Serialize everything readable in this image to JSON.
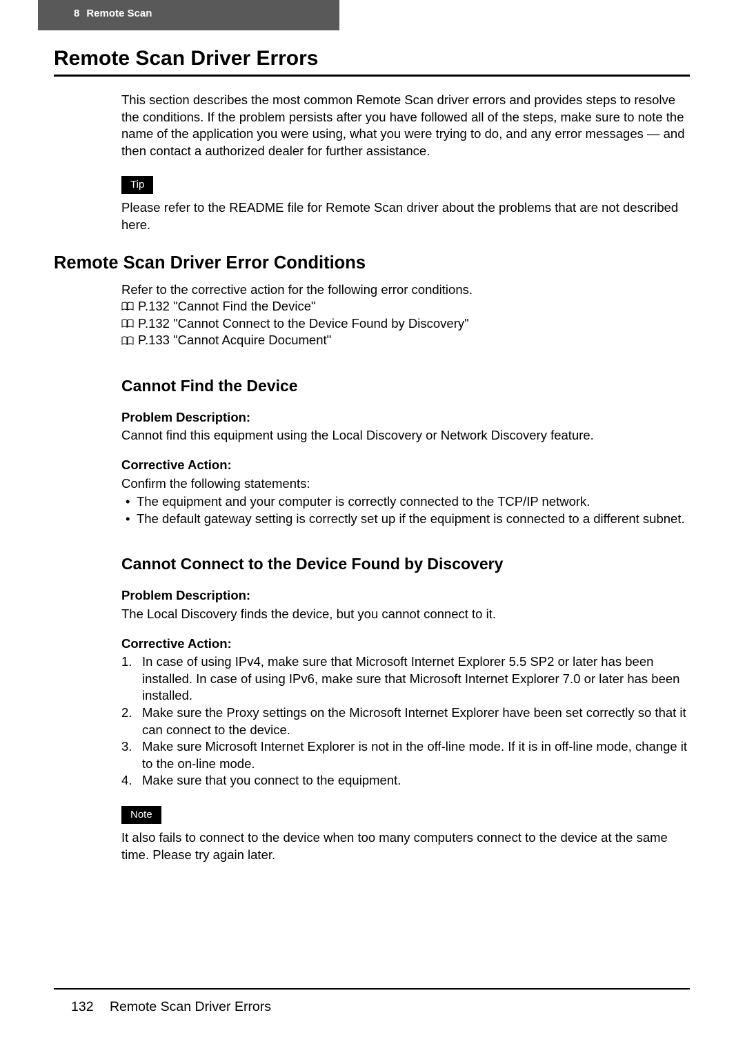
{
  "header": {
    "chapter_number": "8",
    "chapter_title": "Remote Scan"
  },
  "title": "Remote Scan Driver Errors",
  "intro": "This section describes the most common Remote Scan driver errors and provides steps to resolve the conditions. If the problem persists after you have followed all of the steps, make sure to note the name of the application you were using, what you were trying to do, and any error messages — and then contact a authorized dealer for further assistance.",
  "tip_label": "Tip",
  "tip_text": "Please refer to the README file for Remote Scan driver about the problems that are not described here.",
  "section2_title": "Remote Scan Driver Error Conditions",
  "refs": {
    "intro": "Refer to the corrective action for the following error conditions.",
    "items": [
      "P.132 \"Cannot Find the Device\"",
      "P.132 \"Cannot Connect to the Device Found by Discovery\"",
      "P.133 \"Cannot Acquire Document\""
    ]
  },
  "sub1": {
    "title": "Cannot Find the Device",
    "pd_label": "Problem Description:",
    "pd_text": "Cannot find this equipment using the Local Discovery or Network Discovery feature.",
    "ca_label": "Corrective Action:",
    "ca_intro": "Confirm the following statements:",
    "ca_items": [
      "The equipment and your computer is correctly connected to the TCP/IP network.",
      "The default gateway setting is correctly set up if the equipment is connected to a different subnet."
    ]
  },
  "sub2": {
    "title": "Cannot Connect to the Device Found by Discovery",
    "pd_label": "Problem Description:",
    "pd_text": "The Local Discovery finds the device, but you cannot connect to it.",
    "ca_label": "Corrective Action:",
    "ca_items": [
      "In case of using IPv4, make sure that Microsoft Internet Explorer 5.5 SP2 or later has been installed.  In case of using IPv6, make sure that Microsoft Internet Explorer 7.0 or later has been installed.",
      "Make sure the Proxy settings on the Microsoft Internet Explorer have been set correctly so that it can connect to the device.",
      "Make sure Microsoft Internet Explorer is not in the off-line mode.  If it is in off-line mode, change it to the on-line mode.",
      "Make sure that you connect to the equipment."
    ],
    "note_label": "Note",
    "note_text": "It also fails to connect to the device when too many computers connect to the device at the same time.  Please try again later."
  },
  "footer": {
    "page_number": "132",
    "title": "Remote Scan Driver Errors"
  }
}
